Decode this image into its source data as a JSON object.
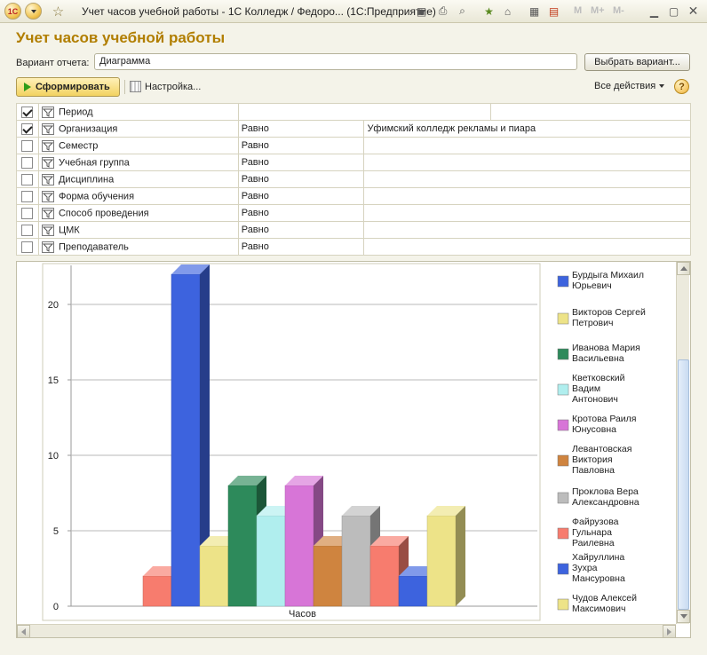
{
  "window": {
    "title": "Учет часов учебной работы - 1С Колледж / Федоро...  (1С:Предприятие)",
    "app_logo": "1С",
    "mem_buttons": [
      "M",
      "M+",
      "M-"
    ]
  },
  "report": {
    "title": "Учет часов учебной работы",
    "variant_label": "Вариант отчета:",
    "variant_value": "Диаграмма",
    "choose_variant": "Выбрать вариант...",
    "generate": "Сформировать",
    "settings": "Настройка...",
    "all_actions": "Все действия",
    "help": "?"
  },
  "filters": [
    {
      "checked": true,
      "field": "Период",
      "condition": "",
      "value": ""
    },
    {
      "checked": true,
      "field": "Организация",
      "condition": "Равно",
      "value": "Уфимский колледж рекламы и пиара"
    },
    {
      "checked": false,
      "field": "Семестр",
      "condition": "Равно",
      "value": ""
    },
    {
      "checked": false,
      "field": "Учебная группа",
      "condition": "Равно",
      "value": ""
    },
    {
      "checked": false,
      "field": "Дисциплина",
      "condition": "Равно",
      "value": ""
    },
    {
      "checked": false,
      "field": "Форма обучения",
      "condition": "Равно",
      "value": ""
    },
    {
      "checked": false,
      "field": "Способ проведения",
      "condition": "Равно",
      "value": ""
    },
    {
      "checked": false,
      "field": "ЦМК",
      "condition": "Равно",
      "value": ""
    },
    {
      "checked": false,
      "field": "Преподаватель",
      "condition": "Равно",
      "value": ""
    }
  ],
  "chart_data": {
    "type": "bar",
    "categories": [
      "Часов"
    ],
    "xlabel": "Часов",
    "ylim": [
      0,
      22
    ],
    "yticks": [
      0,
      5,
      10,
      15,
      20
    ],
    "grid": true,
    "legend_position": "right",
    "series": [
      {
        "name": "Бурдыга Михаил Юрьевич",
        "legend": [
          "Бурдыга Михаил",
          "Юрьевич"
        ],
        "value": 22,
        "color": "#3d63de"
      },
      {
        "name": "Викторов Сергей Петрович",
        "legend": [
          "Викторов Сергей",
          "Петрович"
        ],
        "value": 4,
        "color": "#ede388"
      },
      {
        "name": "Иванова Мария Васильевна",
        "legend": [
          "Иванова Мария",
          "Васильевна"
        ],
        "value": 8,
        "color": "#2d8a5b"
      },
      {
        "name": "Кветковский Вадим Антонович",
        "legend": [
          "Кветковский",
          "Вадим",
          "Антонович"
        ],
        "value": 6,
        "color": "#b0eeee"
      },
      {
        "name": "Кротова Раиля Юнусовна",
        "legend": [
          "Кротова Раиля",
          "Юнусовна"
        ],
        "value": 8,
        "color": "#d775d7"
      },
      {
        "name": "Левантовская Виктория Павловна",
        "legend": [
          "Левантовская",
          "Виктория",
          "Павловна"
        ],
        "value": 4,
        "color": "#cf843f"
      },
      {
        "name": "Проклова Вера Александровна",
        "legend": [
          "Проклова Вера",
          "Александровна"
        ],
        "value": 6,
        "color": "#bcbcbc"
      },
      {
        "name": "Файрузова Гульнара Раилевна",
        "legend": [
          "Файрузова",
          "Гульнара",
          "Раилевна"
        ],
        "value": 4,
        "color": "#f77c6e"
      },
      {
        "name": "Хайруллина Зухра Мансуровна",
        "legend": [
          "Хайруллина",
          "Зухра",
          "Мансуровна"
        ],
        "value": 2,
        "color": "#3d63de"
      },
      {
        "name": "Чудов Алексей Максимович",
        "legend": [
          "Чудов Алексей",
          "Максимович"
        ],
        "value": 6,
        "color": "#ede388"
      }
    ],
    "bar_order": [
      {
        "series": "Файрузова Гульнара Раилевна",
        "value": 2
      },
      {
        "series": "Бурдыга Михаил Юрьевич",
        "value": 22
      },
      {
        "series": "Викторов Сергей Петрович",
        "value": 4
      },
      {
        "series": "Иванова Мария Васильевна",
        "value": 8
      },
      {
        "series": "Кветковский Вадим Антонович",
        "value": 6
      },
      {
        "series": "Кротова Раиля Юнусовна",
        "value": 8
      },
      {
        "series": "Левантовская Виктория Павловна",
        "value": 4
      },
      {
        "series": "Проклова Вера Александровна",
        "value": 6
      },
      {
        "series": "Файрузова Гульнара Раилевна",
        "value": 4
      },
      {
        "series": "Хайруллина Зухра Мансуровна",
        "value": 2
      },
      {
        "series": "Чудов Алексей Максимович",
        "value": 6
      }
    ]
  }
}
